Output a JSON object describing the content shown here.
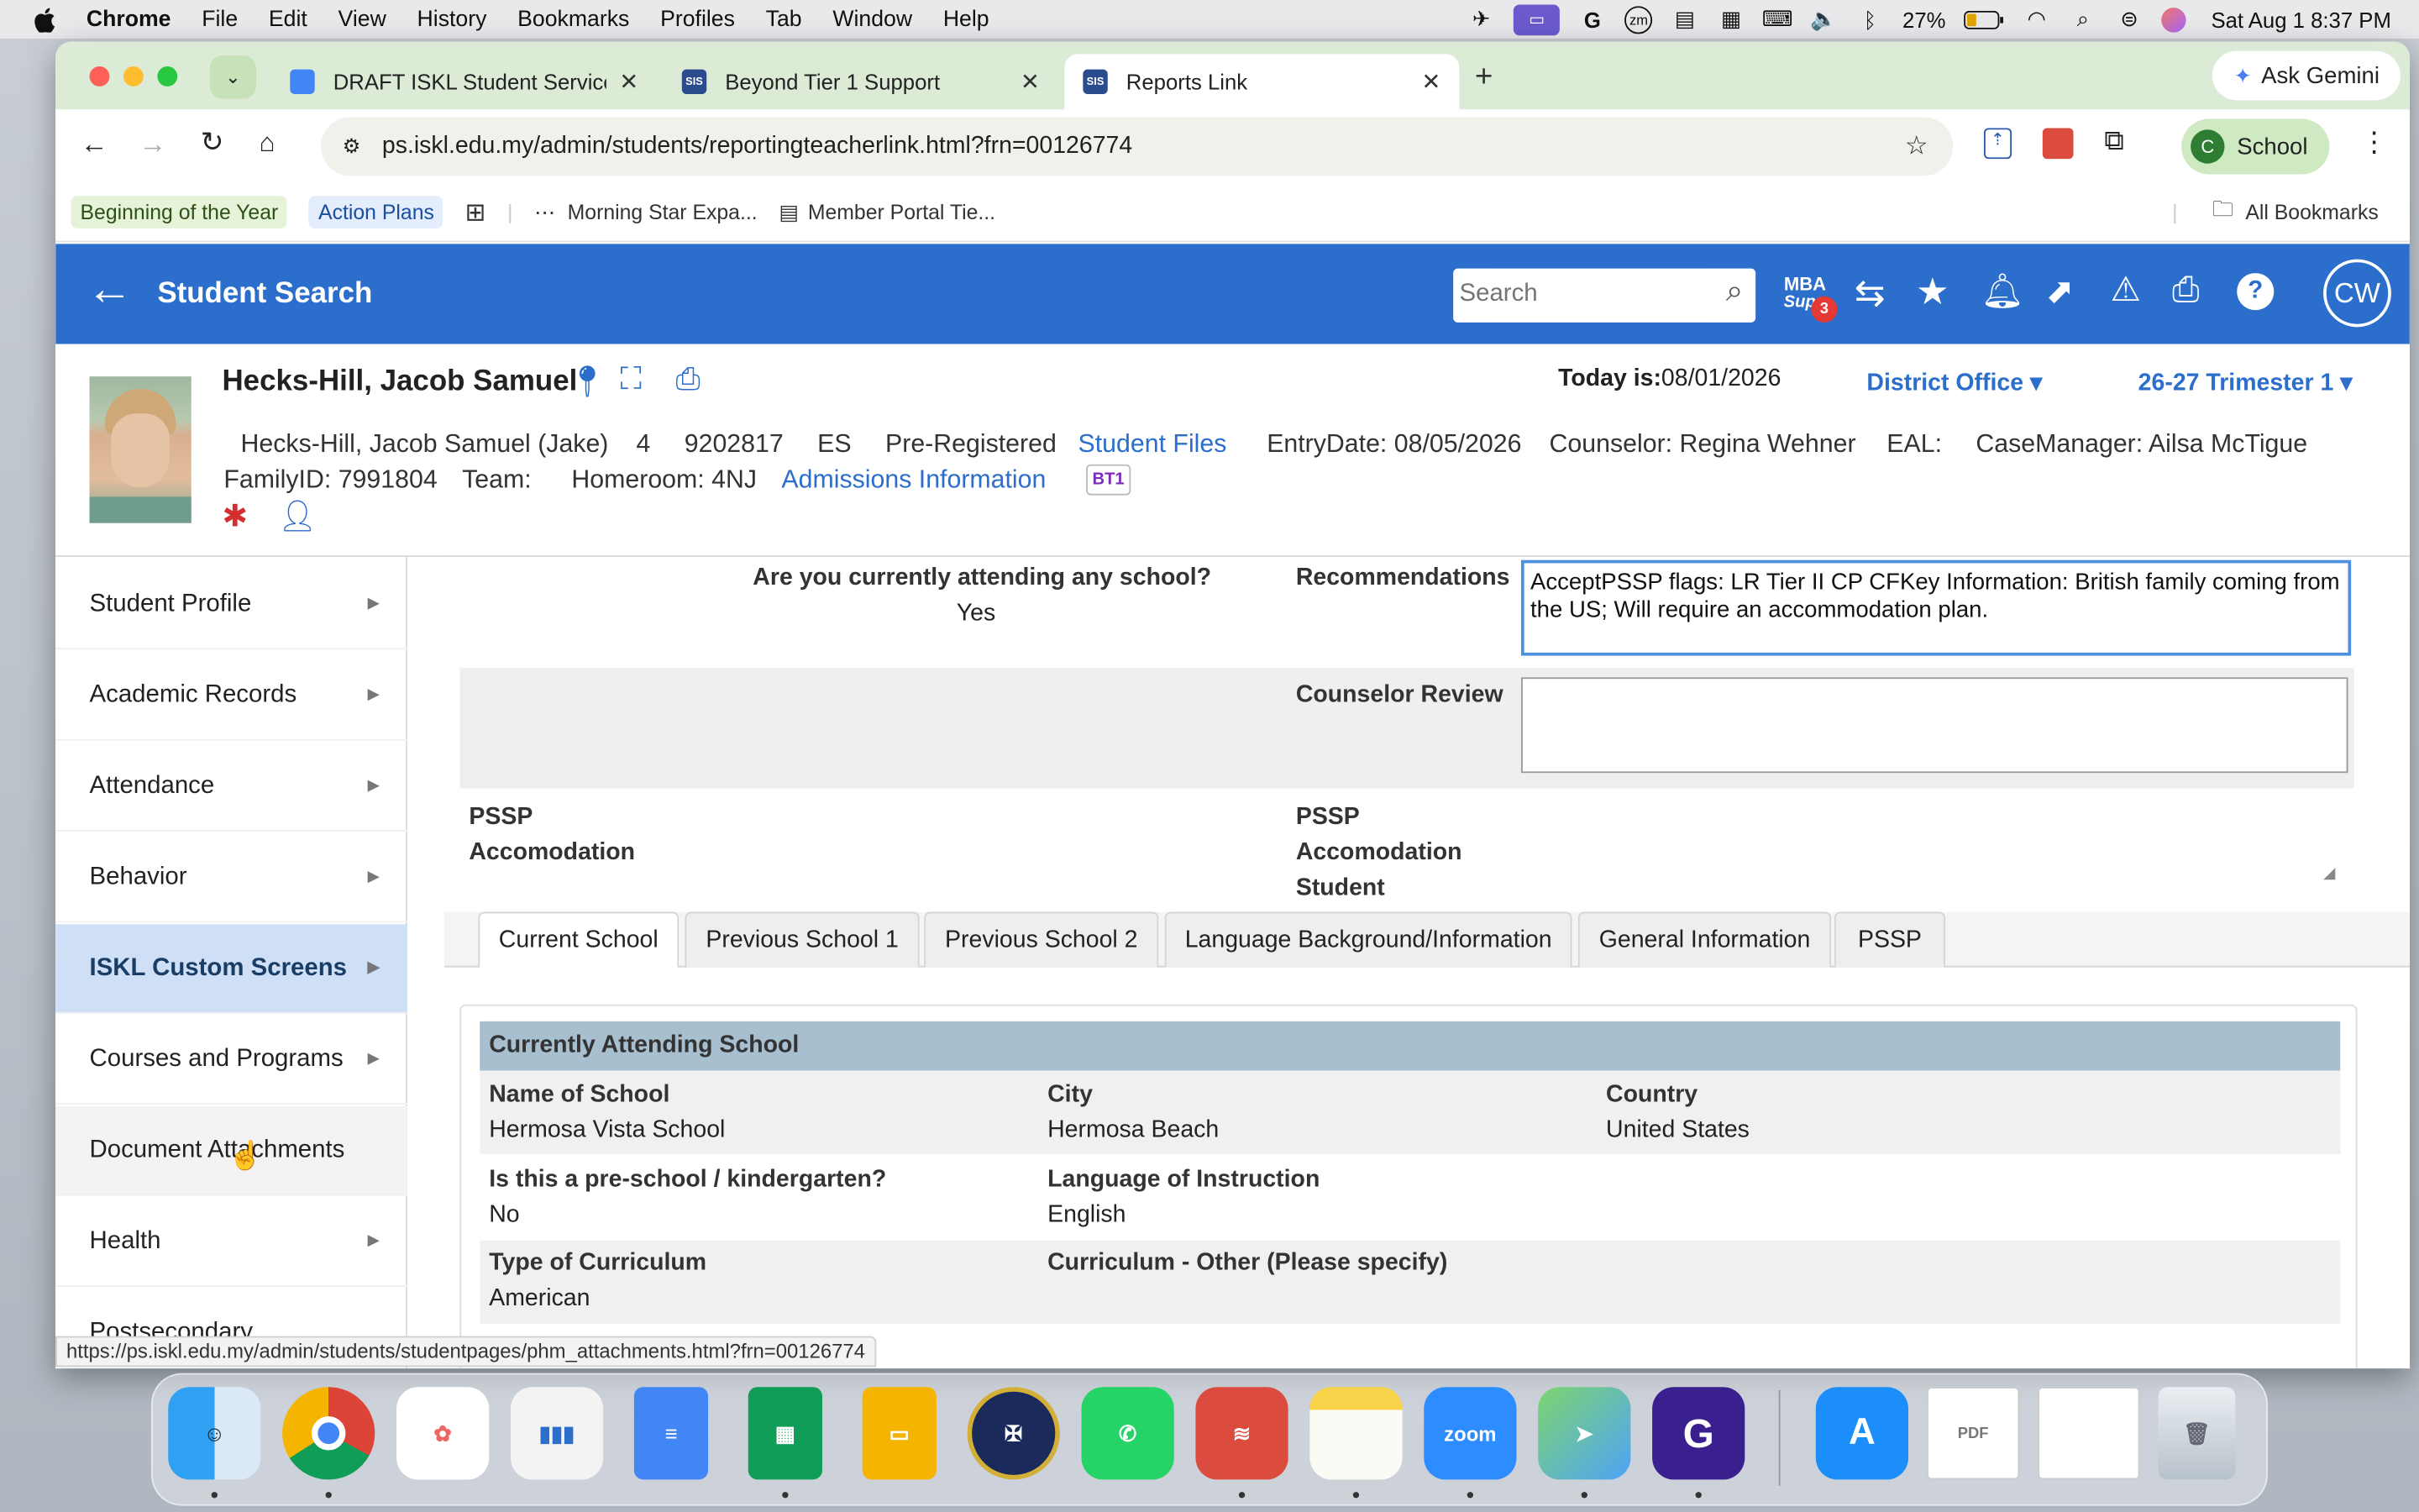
{
  "menubar": {
    "app": "Chrome",
    "items": [
      "File",
      "Edit",
      "View",
      "History",
      "Bookmarks",
      "Profiles",
      "Tab",
      "Window",
      "Help"
    ],
    "battery": "27%",
    "datetime": "Sat Aug 1  8:37 PM"
  },
  "tabs": [
    {
      "label": "DRAFT ISKL Student Services",
      "fav": "#4285f4",
      "favtext": ""
    },
    {
      "label": "Beyond Tier 1 Support",
      "fav": "#2a4b8d",
      "favtext": "SIS"
    },
    {
      "label": "Reports Link",
      "fav": "#2a4b8d",
      "favtext": "SIS"
    }
  ],
  "ask_gemini": "Ask Gemini",
  "url": "ps.iskl.edu.my/admin/students/reportingteacherlink.html?frn=00126774",
  "profile": {
    "initial": "C",
    "label": "School"
  },
  "bookmarks": [
    "Beginning of the Year",
    "Action Plans",
    "Morning Star Expa...",
    "Member Portal Tie..."
  ],
  "all_bookmarks": "All Bookmarks",
  "header": {
    "back_label": "Student Search",
    "search_placeholder": "Search",
    "mba_top": "MBA",
    "mba_bottom": "Supp",
    "mba_badge": "3",
    "user_initials": "CW"
  },
  "student": {
    "name": "Hecks-Hill, Jacob Samuel",
    "fullname": "Hecks-Hill, Jacob Samuel (Jake)",
    "grade": "4",
    "student_number": "9202817",
    "school": "ES",
    "status": "Pre-Registered",
    "student_files": "Student Files",
    "entry_date": "EntryDate: 08/05/2026",
    "counselor": "Counselor: Regina Wehner",
    "eal": "EAL:",
    "case_manager": "CaseManager: Ailsa McTigue",
    "family_id": "FamilyID: 7991804",
    "team": "Team:",
    "homeroom": "Homeroom: 4NJ",
    "admissions": "Admissions Information",
    "badge": "BT1",
    "today_label": "Today is:",
    "today": "08/01/2026",
    "district": "District Office",
    "term": "26-27 Trimester 1"
  },
  "sidebar": [
    "Student Profile",
    "Academic Records",
    "Attendance",
    "Behavior",
    "ISKL Custom Screens",
    "Courses and Programs",
    "Document Attachments",
    "Health",
    "Postsecondary"
  ],
  "form": {
    "attending_q": "Are you currently attending any school?",
    "attending_a": "Yes",
    "recommendations_label": "Recommendations",
    "recommendations_text": "AcceptPSSP flags: LR Tier II CP CFKey Information: British family coming from the US; Will require an accommodation plan.",
    "counselor_review_label": "Counselor Review",
    "pssp_left_1": "PSSP",
    "pssp_left_2": "Accomodation",
    "pssp_right_1": "PSSP",
    "pssp_right_2": "Accomodation",
    "pssp_right_3": "Student"
  },
  "subtabs": [
    "Current School",
    "Previous School 1",
    "Previous School 2",
    "Language Background/Information",
    "General Information",
    "PSSP"
  ],
  "current_school": {
    "section_title": "Currently Attending School",
    "name_label": "Name of School",
    "name": "Hermosa Vista School",
    "city_label": "City",
    "city": "Hermosa Beach",
    "country_label": "Country",
    "country": "United States",
    "preschool_label": "Is this a pre-school / kindergarten?",
    "preschool": "No",
    "lang_label": "Language of Instruction",
    "lang": "English",
    "curriculum_label": "Type of Curriculum",
    "curriculum": "American",
    "curriculum_other_label": "Curriculum - Other (Please specify)"
  },
  "status_url": "https://ps.iskl.edu.my/admin/students/studentpages/phm_attachments.html?frn=00126774"
}
